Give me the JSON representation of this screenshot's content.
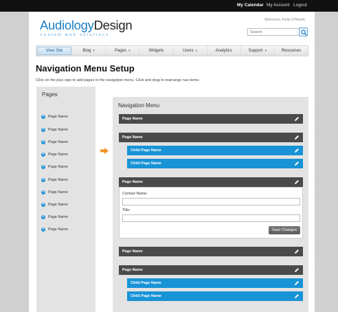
{
  "topbar": {
    "calendar": "My Calendar",
    "account": "My Account",
    "logout": "Logout"
  },
  "header": {
    "logo_part1": "Audiology",
    "logo_part2": "Design",
    "tagline": "custom web solutions",
    "welcome": "Welcome, Kelly O'Keefe",
    "search_placeholder": "Search"
  },
  "nav": [
    {
      "label": "View Site",
      "has_caret": false,
      "active": true
    },
    {
      "label": "Blog",
      "has_caret": true,
      "active": false
    },
    {
      "label": "Pages",
      "has_caret": true,
      "active": false
    },
    {
      "label": "Widgets",
      "has_caret": false,
      "active": false
    },
    {
      "label": "Users",
      "has_caret": true,
      "active": false
    },
    {
      "label": "Analytics",
      "has_caret": false,
      "active": false
    },
    {
      "label": "Support",
      "has_caret": true,
      "active": false
    },
    {
      "label": "Resources",
      "has_caret": false,
      "active": false
    }
  ],
  "main": {
    "title": "Navigation Menu Setup",
    "instructions": "Click on the plus sign to add pages to the navigation menu. Click and drag to rearrange nav items."
  },
  "pages_panel": {
    "heading": "Pages",
    "items": [
      "Page Name",
      "Page Name",
      "Page Name",
      "Page Name",
      "Page Name",
      "Page Name",
      "Page Name",
      "Page Name",
      "Page Name",
      "Page Name"
    ]
  },
  "nav_panel": {
    "heading": "Navigation Menu",
    "items": [
      {
        "label": "Page Name",
        "level": "parent"
      },
      {
        "label": "Page Name",
        "level": "parent"
      },
      {
        "label": "Child Page Name",
        "level": "child"
      },
      {
        "label": "Child Page Name",
        "level": "child"
      },
      {
        "label": "Page Name",
        "level": "parent"
      },
      {
        "label": "Page Name",
        "level": "parent"
      },
      {
        "label": "Page Name",
        "level": "parent"
      },
      {
        "label": "Child Page Name",
        "level": "child"
      },
      {
        "label": "Child Page Name",
        "level": "child"
      }
    ],
    "edit_form": {
      "contact_label": "Contact Name:",
      "contact_value": "",
      "title_label": "Title:",
      "title_value": "",
      "save_label": "Save Changes"
    }
  },
  "colors": {
    "accent_blue": "#1893d6",
    "dark_bar": "#4a4a4a",
    "arrow_orange": "#f29121"
  }
}
